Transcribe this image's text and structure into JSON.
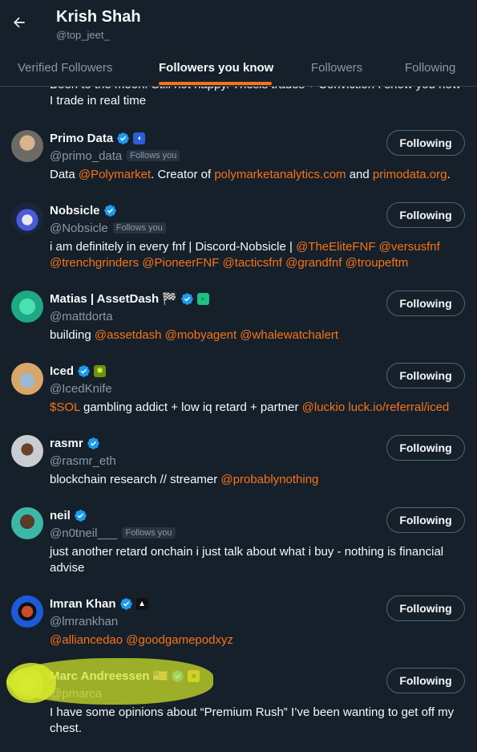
{
  "header": {
    "name": "Krish Shah",
    "handle": "@top_jeet_",
    "tabs": [
      {
        "label": "Verified Followers",
        "active": false
      },
      {
        "label": "Followers you know",
        "active": true
      },
      {
        "label": "Followers",
        "active": false
      },
      {
        "label": "Following",
        "active": false
      }
    ]
  },
  "partial_bio": "Been to the moon. Still not happy. Thesis trades + Conviction I show you how I trade in real time",
  "follows_you_label": "Follows you",
  "following_label": "Following",
  "accent_color": "#f97316",
  "users": [
    {
      "name": "Primo Data",
      "handle": "@primo_data",
      "follows_you": true,
      "bio": [
        {
          "t": "Data "
        },
        {
          "t": "@Polymarket",
          "link": true
        },
        {
          "t": ". Creator of "
        },
        {
          "t": "polymarketanalytics.com",
          "link": true
        },
        {
          "t": " and "
        },
        {
          "t": "primodata.org",
          "link": true
        },
        {
          "t": "."
        }
      ]
    },
    {
      "name": "Nobsicle",
      "handle": "@Nobsicle",
      "follows_you": true,
      "bio": [
        {
          "t": "i am definitely in every fnf | Discord-Nobsicle | "
        },
        {
          "t": "@TheEliteFNF",
          "link": true
        },
        {
          "t": " "
        },
        {
          "t": "@versusfnf",
          "link": true
        },
        {
          "t": " "
        },
        {
          "t": "@trenchgrinders",
          "link": true
        },
        {
          "t": " "
        },
        {
          "t": "@PioneerFNF",
          "link": true
        },
        {
          "t": " "
        },
        {
          "t": "@tacticsfnf",
          "link": true
        },
        {
          "t": " "
        },
        {
          "t": "@grandfnf",
          "link": true
        },
        {
          "t": " "
        },
        {
          "t": "@troupeftm",
          "link": true
        }
      ]
    },
    {
      "name": "Matias | AssetDash 🏁",
      "handle": "@mattdorta",
      "follows_you": false,
      "bio": [
        {
          "t": "building "
        },
        {
          "t": "@assetdash",
          "link": true
        },
        {
          "t": " "
        },
        {
          "t": "@mobyagent",
          "link": true
        },
        {
          "t": " "
        },
        {
          "t": "@whalewatchalert",
          "link": true
        }
      ]
    },
    {
      "name": "Iced",
      "handle": "@IcedKnife",
      "follows_you": false,
      "bio": [
        {
          "t": "$SOL",
          "link": true
        },
        {
          "t": " gambling addict + low iq retard + partner "
        },
        {
          "t": "@luckio",
          "link": true
        },
        {
          "t": " "
        },
        {
          "t": "luck.io/referral/iced",
          "link": true
        }
      ]
    },
    {
      "name": "rasmr",
      "handle": "@rasmr_eth",
      "follows_you": false,
      "bio": [
        {
          "t": "blockchain research // streamer "
        },
        {
          "t": "@probablynothing",
          "link": true
        }
      ]
    },
    {
      "name": "neil",
      "handle": "@n0tneil___",
      "follows_you": true,
      "bio": [
        {
          "t": "just another retard onchain i just talk about what i buy - nothing is financial advise"
        }
      ]
    },
    {
      "name": "Imran Khan",
      "handle": "@lmrankhan",
      "follows_you": false,
      "bio": [
        {
          "t": "@alliancedao",
          "link": true
        },
        {
          "t": " "
        },
        {
          "t": "@goodgamepodxyz",
          "link": true
        }
      ]
    },
    {
      "name": "Marc Andreessen 🇺🇸",
      "handle": "@pmarca",
      "follows_you": false,
      "bio": [
        {
          "t": "I have some opinions about “Premium Rush” I’ve been wanting to get off my chest."
        }
      ]
    }
  ]
}
